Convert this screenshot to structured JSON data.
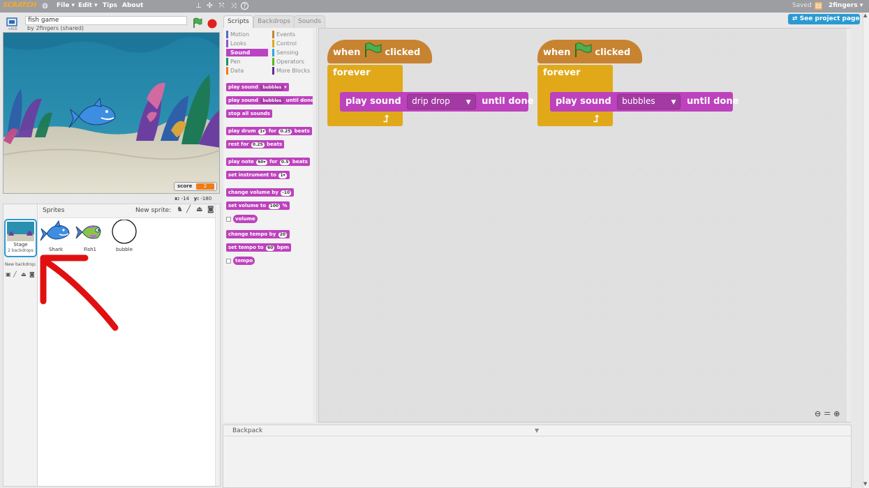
{
  "menubar": {
    "logo": "SCRATCH",
    "items": [
      "File ▾",
      "Edit ▾",
      "Tips",
      "About"
    ],
    "status": "Saved",
    "user": "2fingers ▾"
  },
  "stage_header": {
    "version": "v416",
    "project_title": "fish game",
    "byline": "by 2fingers (shared)"
  },
  "stage": {
    "monitor_label": "score",
    "monitor_value": "2",
    "coords_x_label": "x:",
    "coords_x": "-14",
    "coords_y_label": "y:",
    "coords_y": "-180"
  },
  "sprites_panel": {
    "title": "Sprites",
    "new_sprite_label": "New sprite:",
    "stage_label": "Stage",
    "stage_sub": "2 backdrops",
    "new_backdrop_label": "New backdrop:",
    "sprites": [
      {
        "name": "Shark"
      },
      {
        "name": "Fish1"
      },
      {
        "name": "bubble"
      }
    ]
  },
  "tabs": [
    "Scripts",
    "Backdrops",
    "Sounds"
  ],
  "categories": [
    {
      "label": "Motion",
      "color": "#4a6cd4"
    },
    {
      "label": "Events",
      "color": "#c88330"
    },
    {
      "label": "Looks",
      "color": "#8a55d7"
    },
    {
      "label": "Control",
      "color": "#e1a91a"
    },
    {
      "label": "Sound",
      "color": "#bb42c3"
    },
    {
      "label": "Sensing",
      "color": "#2ca5e2"
    },
    {
      "label": "Pen",
      "color": "#0e9a6c"
    },
    {
      "label": "Operators",
      "color": "#5cb712"
    },
    {
      "label": "Data",
      "color": "#ee7d16"
    },
    {
      "label": "More Blocks",
      "color": "#632d99"
    }
  ],
  "palette": {
    "play_sound": "play sound",
    "play_sound_arg": "bubbles",
    "play_sound_until": "play sound",
    "play_sound_until_arg": "bubbles",
    "until_done": "until done",
    "stop_all": "stop all sounds",
    "play_drum": "play drum",
    "drum_arg": "1▾",
    "for": "for",
    "beats_arg1": "0.25",
    "beats": "beats",
    "rest_for": "rest for",
    "rest_arg": "0.25",
    "play_note": "play note",
    "note_arg": "60▾",
    "note_beats": "0.5",
    "set_instrument": "set instrument to",
    "instrument_arg": "1▾",
    "change_volume": "change volume by",
    "change_volume_arg": "-10",
    "set_volume": "set volume to",
    "set_volume_arg": "100",
    "percent": "%",
    "volume": "volume",
    "change_tempo": "change tempo by",
    "change_tempo_arg": "20",
    "set_tempo": "set tempo to",
    "set_tempo_arg": "60",
    "bpm": "bpm",
    "tempo": "tempo"
  },
  "scripts": [
    {
      "when": "when",
      "clicked": "clicked",
      "forever": "forever",
      "play": "play",
      "sound": "sound",
      "sound_arg": "drip drop",
      "until_done": "until done"
    },
    {
      "when": "when",
      "clicked": "clicked",
      "forever": "forever",
      "play": "play",
      "sound": "sound",
      "sound_arg": "bubbles",
      "until_done": "until done"
    }
  ],
  "see_project": "See project page",
  "backpack": "Backpack",
  "colors": {
    "sound": "#bd42bd",
    "events": "#c88330",
    "control": "#e1a91a",
    "accent": "#2a9ad1"
  }
}
